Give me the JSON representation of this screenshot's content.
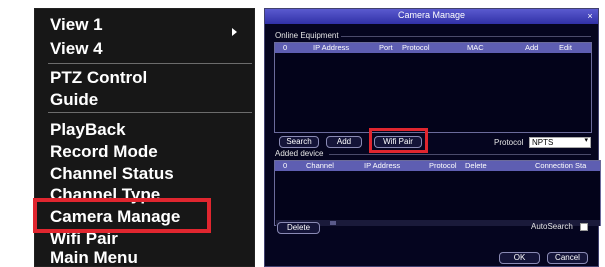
{
  "menu": {
    "items": [
      {
        "label": "View 1"
      },
      {
        "label": "View 4"
      },
      {
        "label": "PTZ Control"
      },
      {
        "label": "Guide"
      },
      {
        "label": "PlayBack"
      },
      {
        "label": "Record Mode"
      },
      {
        "label": "Channel Status"
      },
      {
        "label": "Channel Type"
      },
      {
        "label": "Camera Manage"
      },
      {
        "label": "Wifi Pair"
      },
      {
        "label": "Main Menu"
      }
    ],
    "highlighted_item": "Camera Manage",
    "highlight_color": "#e0262f"
  },
  "dialog": {
    "title": "Camera Manage",
    "close_glyph": "×",
    "online": {
      "section_label": "Online Equipment",
      "columns": [
        "0",
        "IP Address",
        "Port",
        "Protocol",
        "MAC",
        "Add",
        "Edit"
      ]
    },
    "buttons": {
      "search": "Search",
      "add": "Add",
      "wifi_pair": "Wifi Pair",
      "delete": "Delete",
      "ok": "OK",
      "cancel": "Cancel"
    },
    "protocol": {
      "label": "Protocol",
      "value": "NPTS"
    },
    "added": {
      "section_label": "Added device",
      "columns": [
        "0",
        "Channel",
        "IP Address",
        "Protocol",
        "Delete",
        "Connection Sta"
      ]
    },
    "autosearch_label": "AutoSearch",
    "colors": {
      "background": "#05051f",
      "titlebar": "#3b3bb5",
      "header": "#5e5eb2",
      "highlight": "#e0262f"
    }
  }
}
